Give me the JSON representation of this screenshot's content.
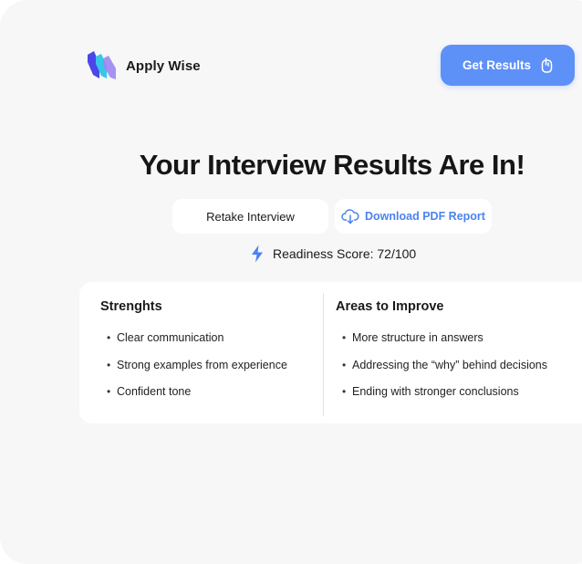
{
  "header": {
    "brand": "Apply Wise",
    "cta_label": "Get Results",
    "cta_icon": "pointer-hand-icon",
    "accent_color": "#5e91f7"
  },
  "main": {
    "title": "Your Interview Results Are In!",
    "retake_label": "Retake Interview",
    "download_label": "Download PDF Report",
    "download_icon": "cloud-download-icon",
    "score_label": "Readiness Score: 72/100",
    "score_icon": "lightning-icon"
  },
  "results": {
    "strengths": {
      "title": "Strenghts",
      "items": [
        "Clear communication",
        "Strong examples from experience",
        "Confident tone"
      ]
    },
    "improve": {
      "title": "Areas to Improve",
      "items": [
        "More structure in answers",
        "Addressing the “why” behind decisions",
        "Ending with stronger conclusions"
      ]
    }
  }
}
